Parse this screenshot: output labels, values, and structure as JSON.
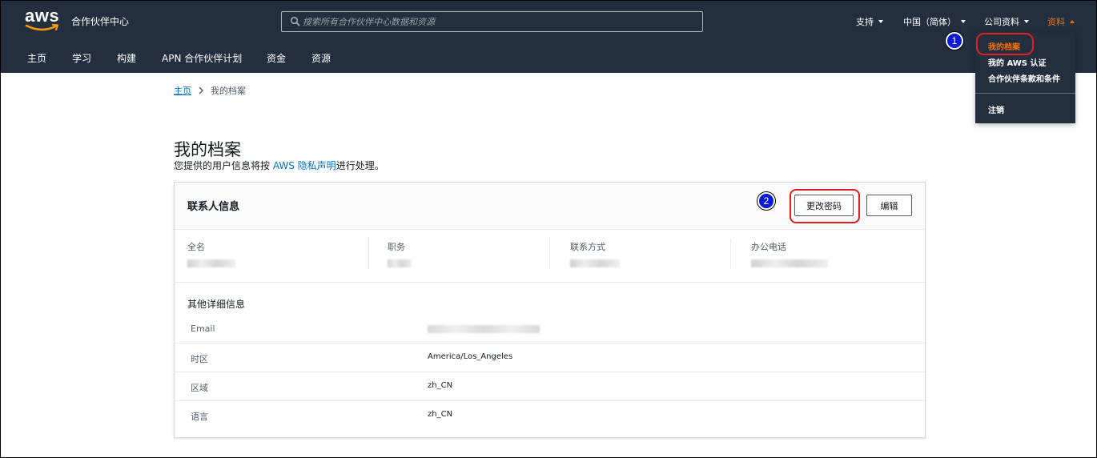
{
  "header": {
    "brand": "aws",
    "app_title": "合作伙伴中心",
    "search_placeholder": "搜索所有合作伙伴中心数据和资源",
    "menus": [
      {
        "label": "支持"
      },
      {
        "label": "中国（简体）"
      },
      {
        "label": "公司资料"
      },
      {
        "label": "资料"
      }
    ]
  },
  "nav": {
    "items": [
      "主页",
      "学习",
      "构建",
      "APN 合作伙伴计划",
      "资金",
      "资源"
    ]
  },
  "dropdown": {
    "items": [
      "我的档案",
      "我的 AWS 认证",
      "合作伙伴条款和条件",
      "注销"
    ]
  },
  "annotations": {
    "step1": "1",
    "step2": "2"
  },
  "breadcrumb": {
    "home": "主页",
    "current": "我的档案"
  },
  "page": {
    "title": "我的档案",
    "subtitle_prefix": "您提供的用户信息将按 ",
    "subtitle_link": "AWS 隐私声明",
    "subtitle_suffix": "进行处理。"
  },
  "contact_card": {
    "title": "联系人信息",
    "change_password": "更改密码",
    "edit": "编辑",
    "fields": [
      "全名",
      "职务",
      "联系方式",
      "办公电话"
    ],
    "other_title": "其他详细信息",
    "details": [
      {
        "key": "Email",
        "value": ""
      },
      {
        "key": "时区",
        "value": "America/Los_Angeles"
      },
      {
        "key": "区域",
        "value": "zh_CN"
      },
      {
        "key": "语言",
        "value": "zh_CN"
      }
    ]
  },
  "colors": {
    "header_bg": "#232f3e",
    "accent": "#ec7211",
    "link": "#0073bb",
    "annotation_red": "#e02020",
    "step_blue": "#0b1ad6"
  }
}
